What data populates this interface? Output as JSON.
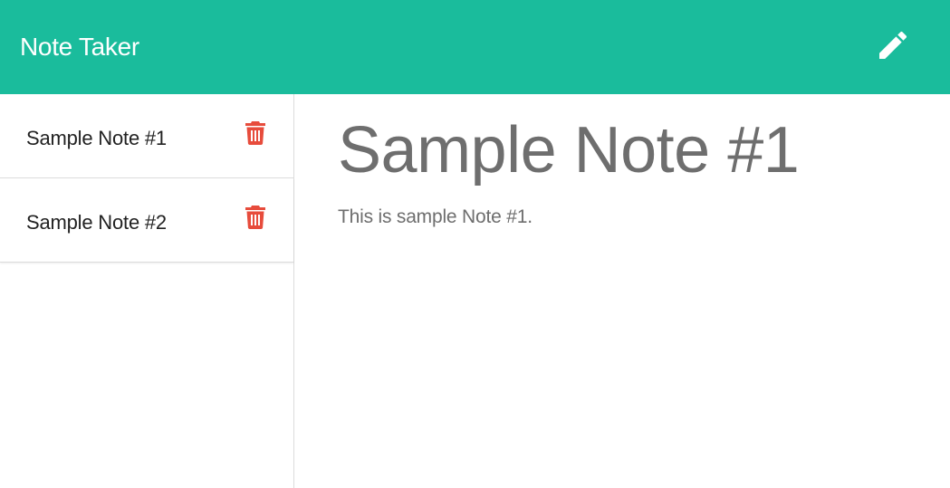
{
  "app": {
    "title": "Note Taker",
    "accent_color": "#1abc9c"
  },
  "toolbar": {
    "new_note_icon": "pencil-icon"
  },
  "sidebar": {
    "delete_icon": "trash-icon",
    "delete_color": "#e74c3c",
    "notes": [
      {
        "title": "Sample Note #1"
      },
      {
        "title": "Sample Note #2"
      }
    ]
  },
  "active_note": {
    "title": "Sample Note #1",
    "text": "This is sample Note #1."
  }
}
